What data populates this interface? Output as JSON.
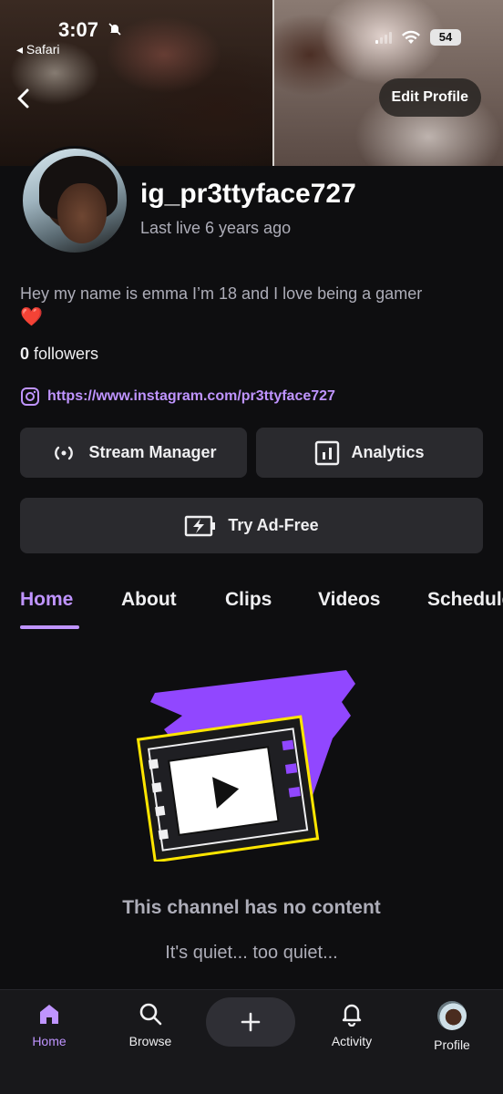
{
  "status_bar": {
    "time": "3:07",
    "back_app": "◂ Safari",
    "battery": "54"
  },
  "header": {
    "edit_profile_label": "Edit Profile"
  },
  "profile": {
    "username": "ig_pr3ttyface727",
    "last_live": "Last live 6 years ago",
    "bio": "Hey my name is emma I’m 18 and I love being a gamer",
    "bio_emoji": "❤️",
    "followers_count": "0",
    "followers_label": "followers",
    "instagram_url": "https://www.instagram.com/pr3ttyface727"
  },
  "actions": {
    "stream_manager": "Stream Manager",
    "analytics": "Analytics",
    "try_ad_free": "Try Ad-Free"
  },
  "tabs": [
    {
      "label": "Home",
      "active": true
    },
    {
      "label": "About",
      "active": false
    },
    {
      "label": "Clips",
      "active": false
    },
    {
      "label": "Videos",
      "active": false
    },
    {
      "label": "Schedule",
      "active": false
    }
  ],
  "empty_state": {
    "title": "This channel has no content",
    "subtitle": "It's quiet... too quiet..."
  },
  "bottom_nav": {
    "home": "Home",
    "browse": "Browse",
    "activity": "Activity",
    "profile": "Profile"
  },
  "colors": {
    "accent": "#bf94ff",
    "background": "#0e0e10",
    "button_bg": "#2a2a2e",
    "illustration_purple": "#9147ff",
    "illustration_yellow": "#ffe600"
  },
  "icons": {
    "back": "chevron-left-icon",
    "stream_manager": "broadcast-icon",
    "analytics": "bar-chart-icon",
    "ad_free": "battery-bolt-icon",
    "instagram": "instagram-icon",
    "home": "home-icon",
    "browse": "search-icon",
    "add": "plus-icon",
    "activity": "bell-icon"
  }
}
